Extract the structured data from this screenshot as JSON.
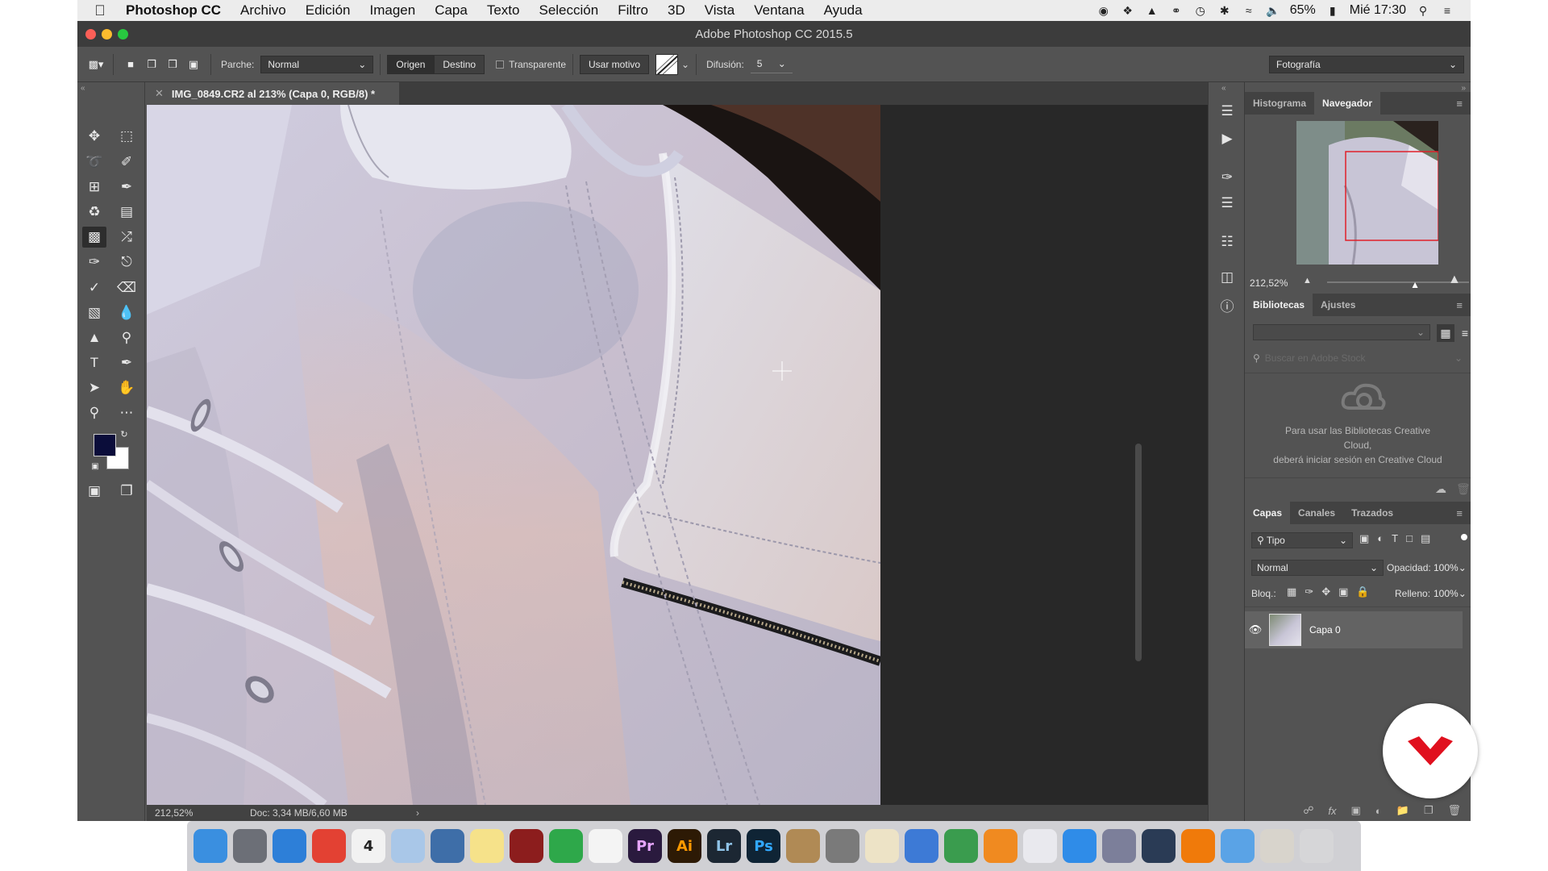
{
  "menubar": {
    "app_name": "Photoshop CC",
    "items": [
      "Archivo",
      "Edición",
      "Imagen",
      "Capa",
      "Texto",
      "Selección",
      "Filtro",
      "3D",
      "Vista",
      "Ventana",
      "Ayuda"
    ],
    "battery": "65%",
    "clock": "Mié 17:30"
  },
  "window": {
    "title": "Adobe Photoshop CC 2015.5"
  },
  "options_bar": {
    "parche_label": "Parche:",
    "parche_value": "Normal",
    "origen": "Origen",
    "destino": "Destino",
    "transparente": "Transparente",
    "usar_motivo": "Usar motivo",
    "difusion_label": "Difusión:",
    "difusion_value": "5",
    "workspace": "Fotografía"
  },
  "document": {
    "tab_title": "IMG_0849.CR2 al 213% (Capa 0, RGB/8) *",
    "zoom": "212,52%",
    "doc_info": "Doc: 3,34 MB/6,60 MB"
  },
  "navigator": {
    "tabs": [
      "Histograma",
      "Navegador"
    ],
    "active_tab": "Navegador",
    "zoom": "212,52%",
    "zoom_level": 0.62
  },
  "libraries": {
    "tabs": [
      "Bibliotecas",
      "Ajustes"
    ],
    "search_placeholder": "Buscar en Adobe Stock",
    "message_line1": "Para usar las Bibliotecas Creative",
    "message_line2": "Cloud,",
    "message_line3": "deberá iniciar sesión en Creative Cloud"
  },
  "layers": {
    "tabs": [
      "Capas",
      "Canales",
      "Trazados"
    ],
    "filter": "Tipo",
    "blend_mode": "Normal",
    "opacity_label": "Opacidad:",
    "opacity_value": "100%",
    "lock_label": "Bloq.:",
    "fill_label": "Relleno:",
    "fill_value": "100%",
    "layer_name": "Capa 0"
  },
  "dock": {
    "apps": [
      {
        "name": "Finder",
        "label": "",
        "color": "#3a8fe0"
      },
      {
        "name": "Launchpad",
        "label": "",
        "color": "#6c6f77"
      },
      {
        "name": "Safari",
        "label": "",
        "color": "#2d7fd8"
      },
      {
        "name": "Chrome",
        "label": "",
        "color": "#e34133"
      },
      {
        "name": "Calendar",
        "label": "4",
        "color": "#f2f2f2"
      },
      {
        "name": "Preview",
        "label": "",
        "color": "#a9c7e8"
      },
      {
        "name": "Xcode Preview",
        "label": "",
        "color": "#3e6ea8"
      },
      {
        "name": "Notes",
        "label": "",
        "color": "#f6e28a"
      },
      {
        "name": "Photo Booth",
        "label": "",
        "color": "#8c1d1d"
      },
      {
        "name": "FaceTime",
        "label": "",
        "color": "#2ea84a"
      },
      {
        "name": "Photos",
        "label": "",
        "color": "#f4f4f4"
      },
      {
        "name": "Premiere",
        "label": "Pr",
        "color": "#2a1a3e"
      },
      {
        "name": "Illustrator",
        "label": "Ai",
        "color": "#2d1a05"
      },
      {
        "name": "Lightroom",
        "label": "Lr",
        "color": "#1c2733"
      },
      {
        "name": "Photoshop",
        "label": "Ps",
        "color": "#0f2435"
      },
      {
        "name": "Contacts",
        "label": "",
        "color": "#b08a55"
      },
      {
        "name": "System Preferences",
        "label": "",
        "color": "#7a7a7a"
      },
      {
        "name": "TextEdit",
        "label": "",
        "color": "#ede3c6"
      },
      {
        "name": "Keynote",
        "label": "",
        "color": "#3d7ad6"
      },
      {
        "name": "Numbers",
        "label": "",
        "color": "#3a9c4e"
      },
      {
        "name": "iBooks",
        "label": "",
        "color": "#f08a20"
      },
      {
        "name": "iTunes",
        "label": "",
        "color": "#e9e9ee"
      },
      {
        "name": "App Store",
        "label": "",
        "color": "#2f8ce8"
      },
      {
        "name": "Creative Cloud",
        "label": "",
        "color": "#7c7f9a"
      },
      {
        "name": "QuickTime",
        "label": "",
        "color": "#2a3b55"
      },
      {
        "name": "VLC",
        "label": "",
        "color": "#f07a0a"
      },
      {
        "name": "Folder",
        "label": "",
        "color": "#5aa3e6"
      },
      {
        "name": "Downloads",
        "label": "",
        "color": "#d8d4cc"
      },
      {
        "name": "Trash",
        "label": "",
        "color": "#d6d6d8"
      }
    ]
  }
}
